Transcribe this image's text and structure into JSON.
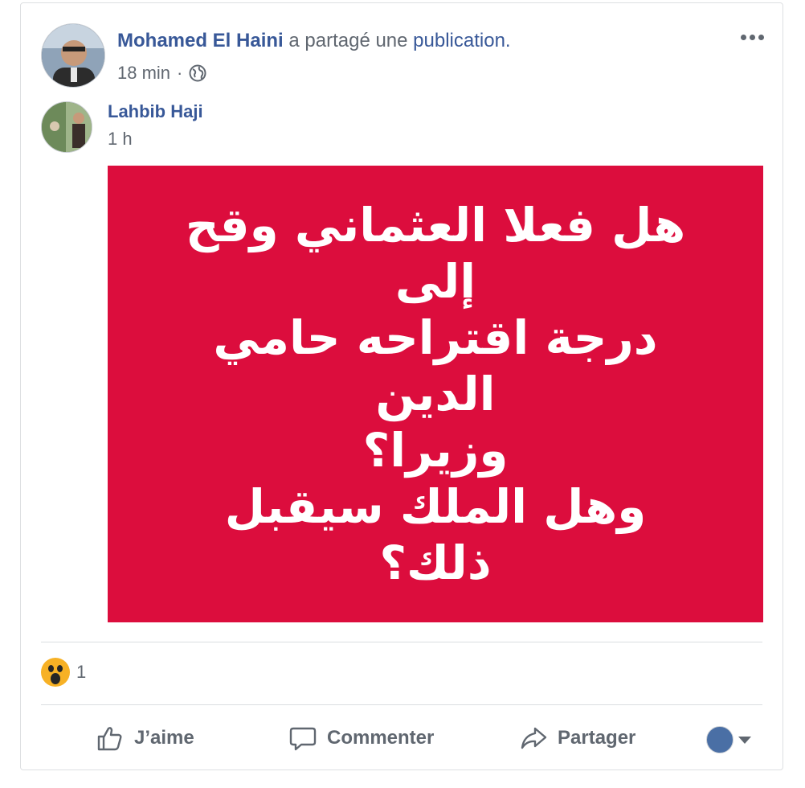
{
  "header": {
    "author": "Mohamed El Haini",
    "shared_text": " a partagé une ",
    "publication_link": "publication.",
    "time": "18 min",
    "separator": "·"
  },
  "shared_post": {
    "author": "Lahbib Haji",
    "time": "1 h",
    "image_text": "هل فعلا العثماني وقح إلى\nدرجة اقتراحه حامي الدين\nوزيرا؟\nوهل الملك سيقبل ذلك؟",
    "image_bg": "#dc0d3d"
  },
  "reactions": {
    "type": "wow-icon",
    "count": "1"
  },
  "actions": {
    "like": "J’aime",
    "comment": "Commenter",
    "share": "Partager"
  },
  "colors": {
    "link": "#385898",
    "text_secondary": "#606770"
  }
}
